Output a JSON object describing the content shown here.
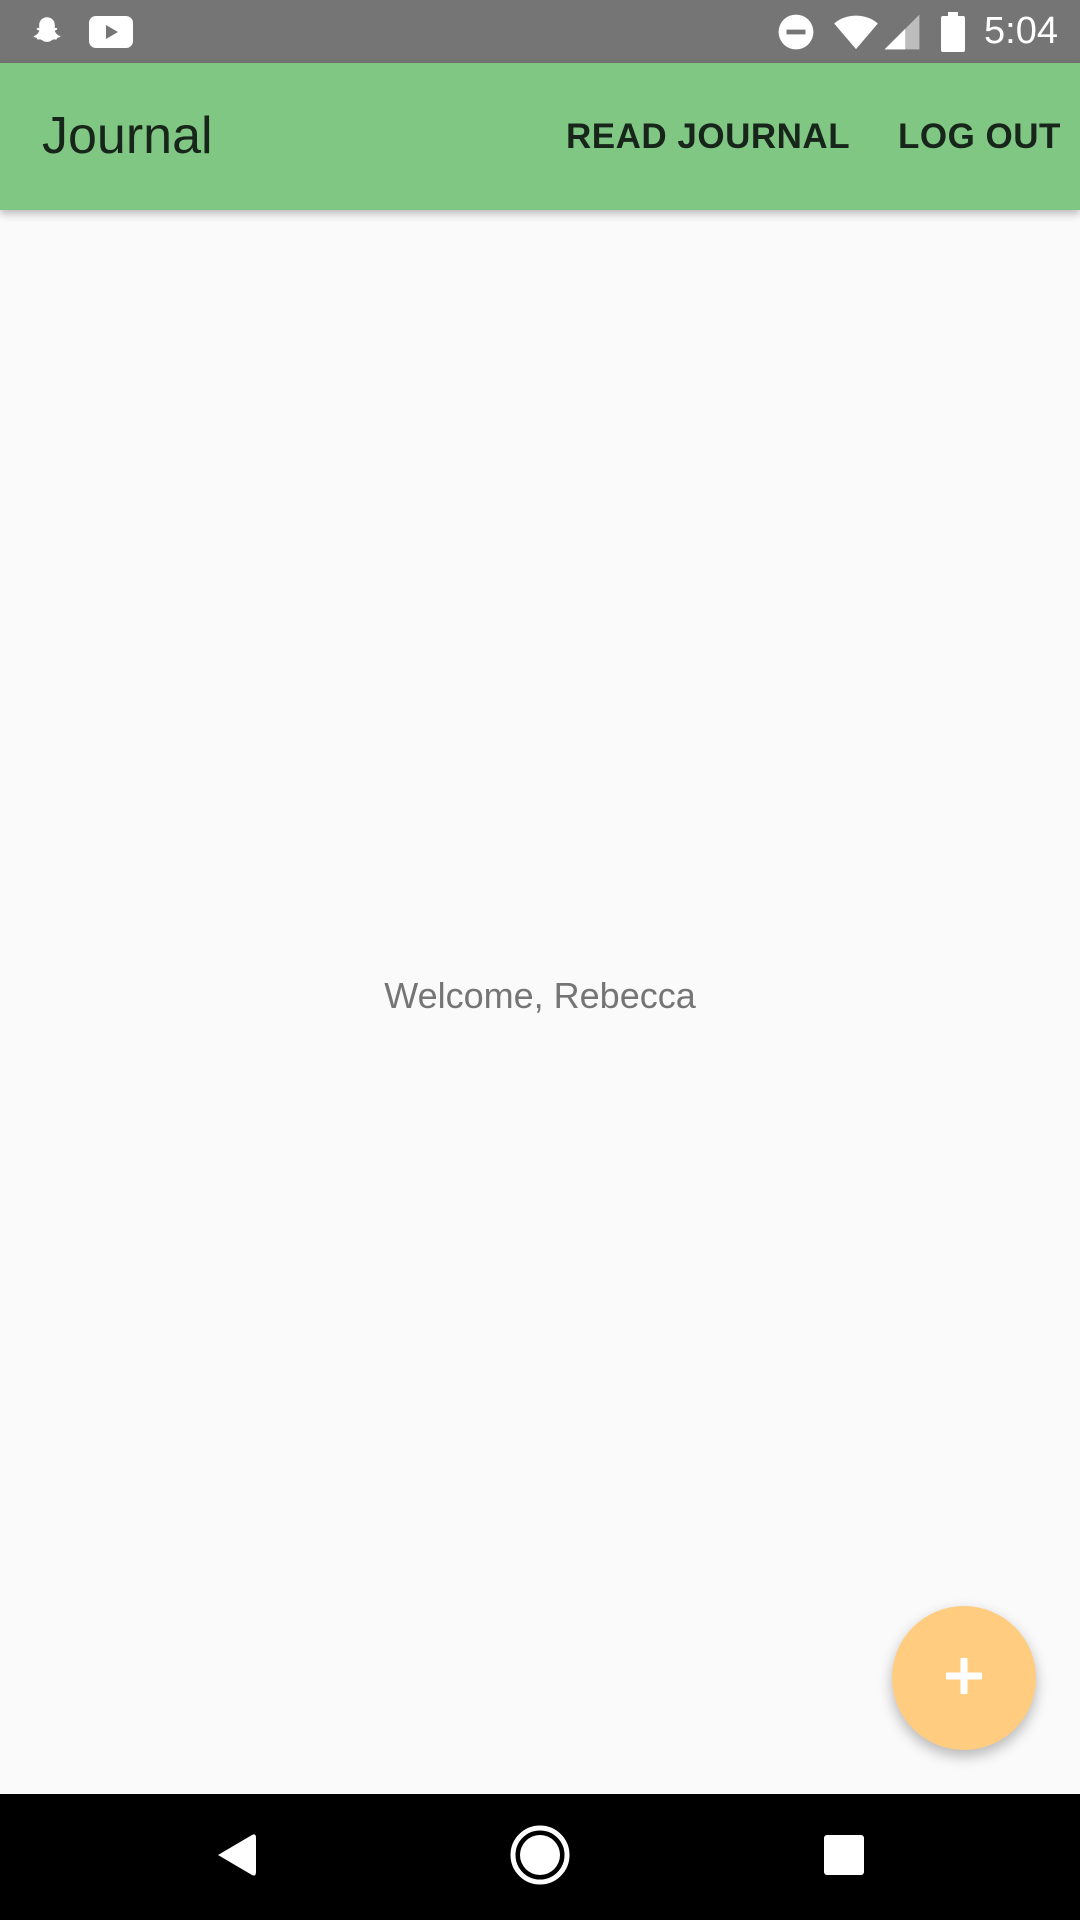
{
  "status_bar": {
    "time": "5:04",
    "icons": [
      "snapchat-icon",
      "youtube-icon",
      "do-not-disturb-icon",
      "wifi-icon",
      "cell-signal-icon",
      "battery-icon"
    ],
    "background": "#757575"
  },
  "app_bar": {
    "title": "Journal",
    "actions": {
      "read_journal": "READ JOURNAL",
      "log_out": "LOG OUT"
    },
    "background": "#81c784"
  },
  "main": {
    "welcome_text": "Welcome, Rebecca",
    "background": "#fafafa"
  },
  "fab": {
    "icon": "plus-icon",
    "color": "#ffcc80"
  },
  "nav_bar": {
    "buttons": [
      "back-icon",
      "home-icon",
      "recents-icon"
    ],
    "background": "#000000"
  }
}
